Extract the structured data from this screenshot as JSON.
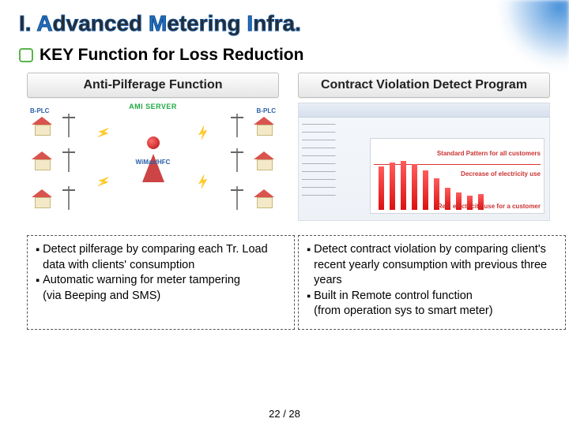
{
  "title": {
    "prefix": "I. ",
    "word1_first": "A",
    "word1_rest": "dvanced ",
    "word2_first": "M",
    "word2_rest": "etering ",
    "word3_first": "I",
    "word3_rest": "nfra."
  },
  "subhead": "KEY Function for Loss Reduction",
  "left": {
    "header": "Anti-Pilferage Function",
    "diagram": {
      "server_label": "AMI SERVER",
      "link_label": "WiMax/HFC",
      "tag_tl": "B-PLC",
      "tag_tr": "B-PLC"
    },
    "bullets": [
      "Detect pilferage by comparing each Tr. Load data with clients' consumption",
      "Automatic warning for meter tampering\n(via Beeping and SMS)"
    ]
  },
  "right": {
    "header": "Contract Violation Detect Program",
    "chart": {
      "label_top": "Standard Pattern for all customers",
      "label_mid": "Decrease of electricity use",
      "label_bot": "Real electricity use for a customer"
    },
    "bullets": [
      "Detect contract violation by comparing client's recent yearly consumption with previous three years",
      "Built in Remote control function\n(from operation sys to smart meter)"
    ]
  },
  "page": {
    "current": "22",
    "sep": " / ",
    "total": "28"
  },
  "glyphs": {
    "square_bullet": "▪",
    "bolt": "⚡"
  }
}
